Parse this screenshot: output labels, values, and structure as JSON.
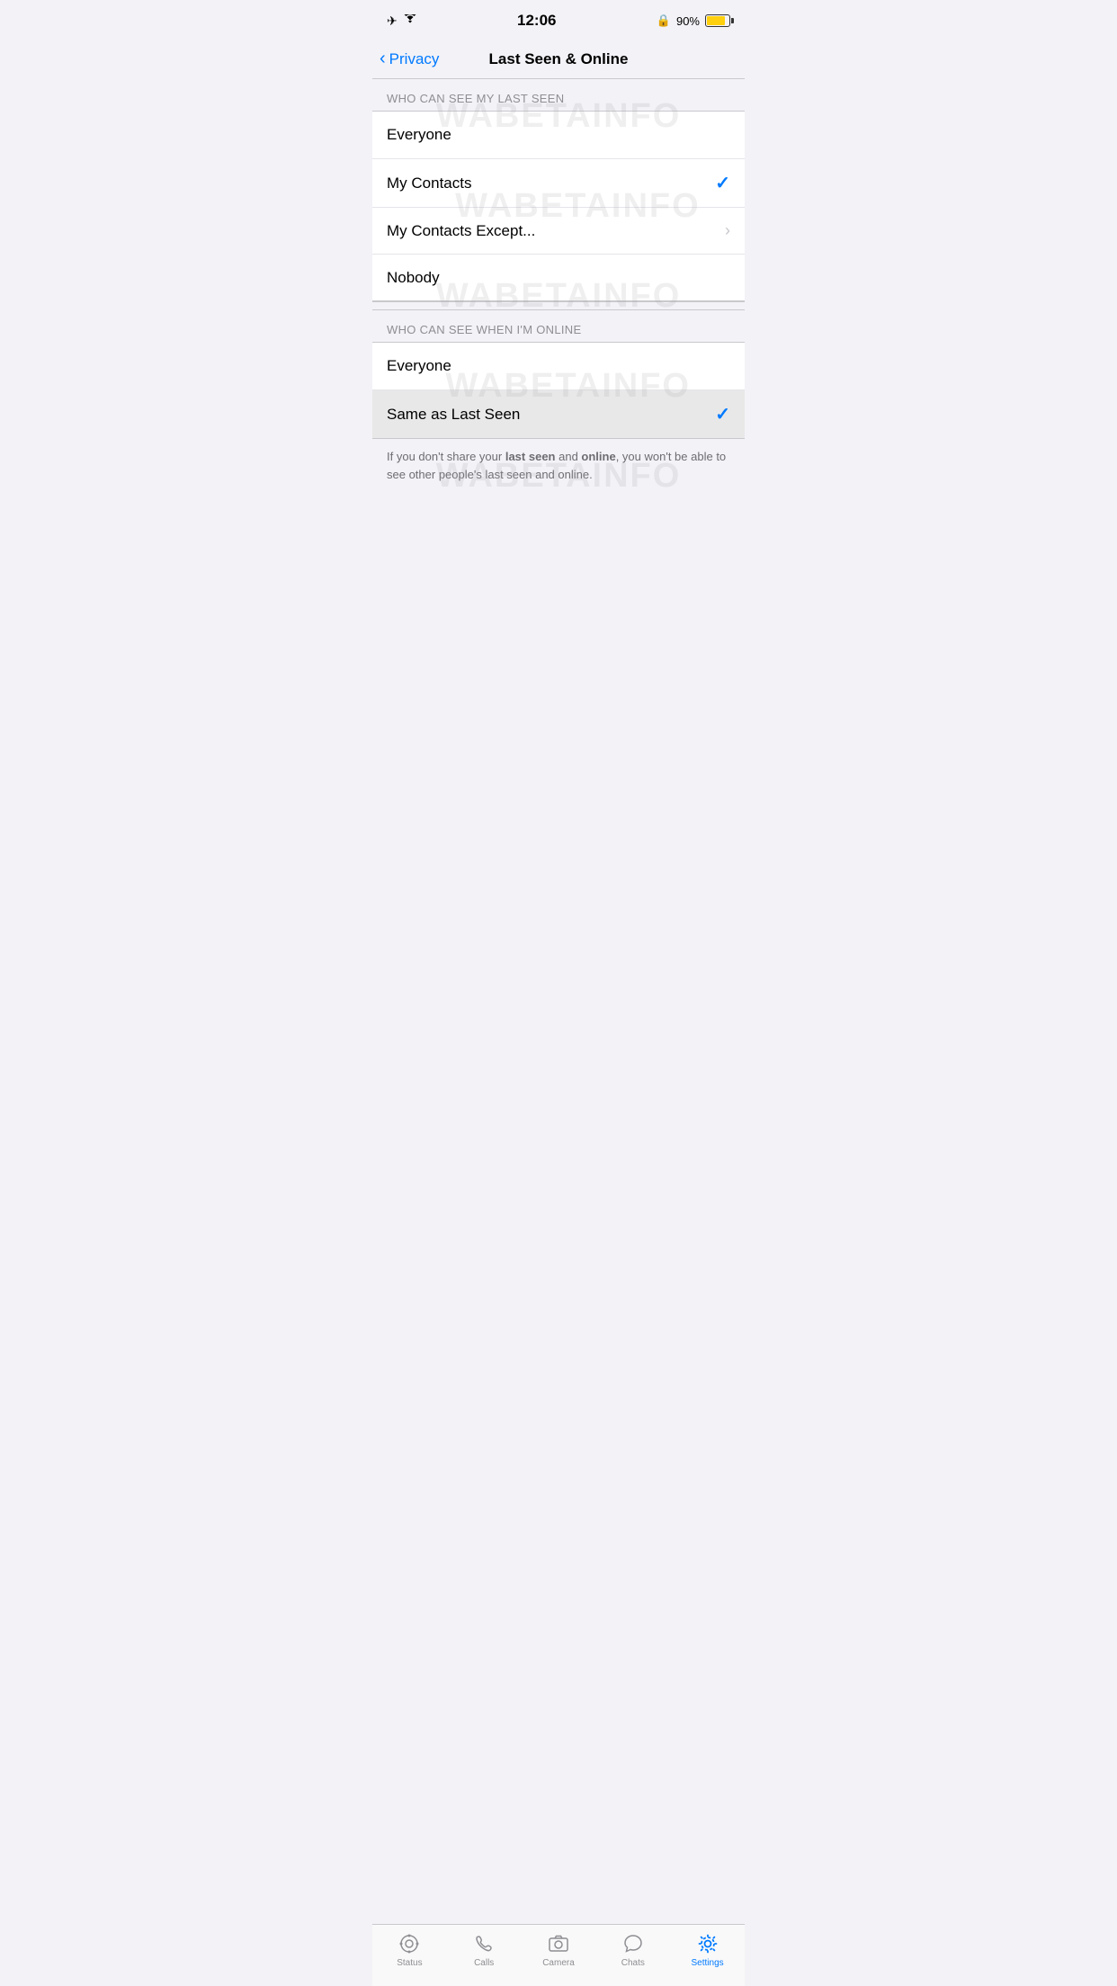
{
  "statusBar": {
    "time": "12:06",
    "battery": "90%"
  },
  "navBar": {
    "backLabel": "Privacy",
    "title": "Last Seen & Online"
  },
  "watermark": "WABETAINFO",
  "lastSeenSection": {
    "header": "WHO CAN SEE MY LAST SEEN",
    "options": [
      {
        "label": "Everyone",
        "checked": false,
        "hasChevron": false
      },
      {
        "label": "My Contacts",
        "checked": true,
        "hasChevron": false
      },
      {
        "label": "My Contacts Except...",
        "checked": false,
        "hasChevron": true
      },
      {
        "label": "Nobody",
        "checked": false,
        "hasChevron": false
      }
    ]
  },
  "onlineSection": {
    "header": "WHO CAN SEE WHEN I'M ONLINE",
    "options": [
      {
        "label": "Everyone",
        "checked": false,
        "hasChevron": false
      },
      {
        "label": "Same as Last Seen",
        "checked": true,
        "hasChevron": false
      }
    ]
  },
  "infoText": {
    "text1": "If you don't share your ",
    "bold1": "last seen",
    "text2": " and ",
    "bold2": "online",
    "text3": ", you won't be able to see other people's last seen and online."
  },
  "tabBar": {
    "items": [
      {
        "id": "status",
        "label": "Status",
        "active": false
      },
      {
        "id": "calls",
        "label": "Calls",
        "active": false
      },
      {
        "id": "camera",
        "label": "Camera",
        "active": false
      },
      {
        "id": "chats",
        "label": "Chats",
        "active": false
      },
      {
        "id": "settings",
        "label": "Settings",
        "active": true
      }
    ]
  }
}
